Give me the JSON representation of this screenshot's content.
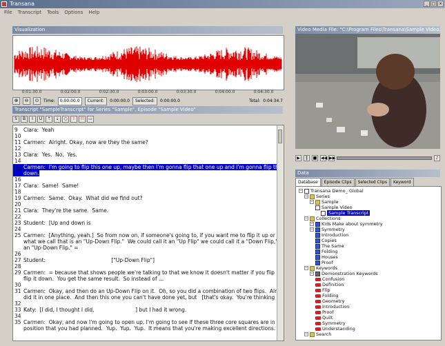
{
  "window": {
    "title": "Transana"
  },
  "menu": [
    "File",
    "Transcript",
    "Tools",
    "Options",
    "Help"
  ],
  "visualization": {
    "title": "Visualization",
    "ruler": [
      "0:01:30.0",
      "0:02:00.0",
      "0:02:30.0",
      "0:03:00.0",
      "0:03:30.0",
      "0:04:00.0",
      "0:04:30.0"
    ],
    "time_label": "Time:",
    "time_value": "0:00:00.0",
    "current_label": "Current:",
    "current_value": "0:00:00.0",
    "selected_label": "Selected:",
    "selected_value": "0:00:00.0",
    "total_label": "Total:",
    "total_value": "0:04:34.7"
  },
  "transcript": {
    "title": "Transcript \"SampleTranscript\" for Series \"Sample\", Episode \"Sample Video\"",
    "toolbar": [
      "S",
      "B",
      "I",
      "U",
      "⇡",
      "⇣",
      "○",
      "!",
      "!!",
      "▭"
    ],
    "lines": [
      {
        "n": "9",
        "t": "Clara:  Yeah"
      },
      {
        "n": "10",
        "t": ""
      },
      {
        "n": "11",
        "t": "Carmen:  Alright. Okay, now are they the same?"
      },
      {
        "n": "12",
        "t": ""
      },
      {
        "n": "13",
        "t": "Clara:  Yes.  No.  Yes."
      },
      {
        "n": "14",
        "t": ""
      },
      {
        "n": "15",
        "t": "Carmen:  I'm going to flip this one up, maybe then I'm gonna flip that one up and I'm gonna flip this one",
        "hl": true
      },
      {
        "n": "",
        "t": "down.",
        "hl": true
      },
      {
        "n": "16",
        "t": ""
      },
      {
        "n": "17",
        "t": "Clara:  Same!  Same!"
      },
      {
        "n": "18",
        "t": ""
      },
      {
        "n": "19",
        "t": "Carmen:  Same.  Okay.  What did we find out?"
      },
      {
        "n": "20",
        "t": ""
      },
      {
        "n": "21",
        "t": "Clara:  They're the same.  Same."
      },
      {
        "n": "22",
        "t": ""
      },
      {
        "n": "23",
        "t": "Student:  [Up and down is"
      },
      {
        "n": "24",
        "t": ""
      },
      {
        "n": "25",
        "t": "Carmen:  [Anything, yeah.]  So from now on, if someone's going to, if you want me to flip it up or down,"
      },
      {
        "n": "",
        "t": "what we call that is an \"Up-Down Flip.\"  We could call it an \"Up Flip\" we could call it a \"Down Flip,\" we'll call it"
      },
      {
        "n": "",
        "t": "an \"Up-Down Flip.\" ="
      },
      {
        "n": "26",
        "t": ""
      },
      {
        "n": "27",
        "t": "Student:                                        [\"Up-Down Flip\"]"
      },
      {
        "n": "28",
        "t": ""
      },
      {
        "n": "29",
        "t": "Carmen:  = because that shows people we're talking to that we know it doesn't matter if you flip it up or if you"
      },
      {
        "n": "",
        "t": "flip it down.  You get the same result.  So instead of ..."
      },
      {
        "n": "30",
        "t": ""
      },
      {
        "n": "31",
        "t": "Carmen:  Okay, and then do an Up-Down Flip on it.  Oh, so you did a combination of two flips.  Alright.  And"
      },
      {
        "n": "",
        "t": "did it in one place.  And then this one you can't have done yet, but   [that's okay.  You're thinking about it.]"
      },
      {
        "n": "32",
        "t": ""
      },
      {
        "n": "33",
        "t": "Katy:  [I did, I thought I did,                         ] but I had it wrong."
      },
      {
        "n": "34",
        "t": ""
      },
      {
        "n": "35",
        "t": "Carmen:  Okay, and now I'm going to open up, I'm going to see if these three core squares are in the"
      },
      {
        "n": "",
        "t": "position that you had planned.  Yup.  Yup.  Yup.  It means that you're making excellent directions."
      }
    ]
  },
  "video": {
    "title": "Video Media File: \"C:\\Program Files\\Transana\\Sample Video.mpg\""
  },
  "data": {
    "title": "Data",
    "tabs": [
      "Database",
      "Episode Clips",
      "Selected Clips",
      "Keyword"
    ],
    "tree": [
      {
        "label": "Transana Demo_ Global",
        "indent": 0,
        "icon": "doc"
      },
      {
        "label": "Series",
        "indent": 1,
        "icon": "folder"
      },
      {
        "label": "Sample",
        "indent": 2,
        "icon": "folder"
      },
      {
        "label": "Sample Video",
        "indent": 3,
        "icon": "doc"
      },
      {
        "label": "Sample Transcript",
        "indent": 4,
        "icon": "doc",
        "selected": true
      },
      {
        "label": "Collections",
        "indent": 1,
        "icon": "folder"
      },
      {
        "label": "Kids Make about symmetry",
        "indent": 2,
        "icon": "blue"
      },
      {
        "label": "Symmetry",
        "indent": 2,
        "icon": "blue"
      },
      {
        "label": "Introduction",
        "indent": 3,
        "icon": "blue"
      },
      {
        "label": "Copies",
        "indent": 3,
        "icon": "blue"
      },
      {
        "label": "The Same",
        "indent": 3,
        "icon": "blue"
      },
      {
        "label": "Folding",
        "indent": 3,
        "icon": "blue"
      },
      {
        "label": "Houses",
        "indent": 3,
        "icon": "blue"
      },
      {
        "label": "Proof",
        "indent": 3,
        "icon": "blue"
      },
      {
        "label": "Keywords",
        "indent": 1,
        "icon": "folder"
      },
      {
        "label": "Demonstration Keywords",
        "indent": 2,
        "icon": "kw"
      },
      {
        "label": "Confusion",
        "indent": 3,
        "icon": "red"
      },
      {
        "label": "Definition",
        "indent": 3,
        "icon": "red"
      },
      {
        "label": "Flip",
        "indent": 3,
        "icon": "red"
      },
      {
        "label": "Folding",
        "indent": 3,
        "icon": "red"
      },
      {
        "label": "Geometry",
        "indent": 3,
        "icon": "red"
      },
      {
        "label": "Introduction",
        "indent": 3,
        "icon": "red"
      },
      {
        "label": "Proof",
        "indent": 3,
        "icon": "red"
      },
      {
        "label": "Quilt",
        "indent": 3,
        "icon": "red"
      },
      {
        "label": "Symmetry",
        "indent": 3,
        "icon": "red"
      },
      {
        "label": "Understanding",
        "indent": 3,
        "icon": "red"
      },
      {
        "label": "Search",
        "indent": 1,
        "icon": "folder"
      }
    ]
  }
}
